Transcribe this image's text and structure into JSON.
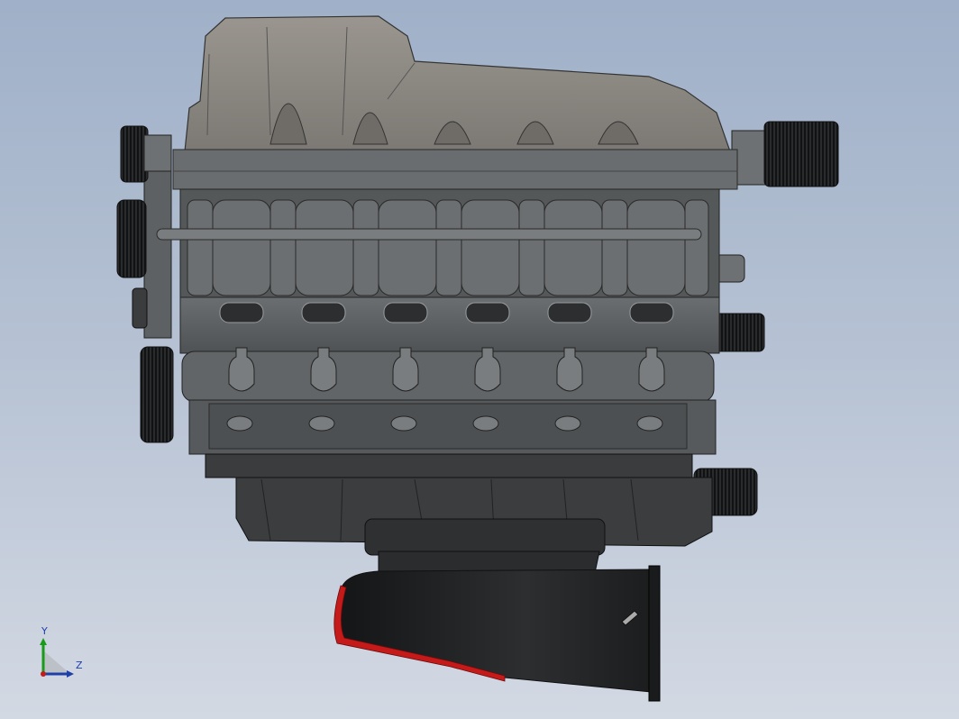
{
  "viewport": {
    "background_top": "#9fb0c8",
    "background_bottom": "#d3d9e3"
  },
  "model": {
    "subject": "engine-assembly",
    "colors": {
      "body": "#5b5e60",
      "body_light": "#7a7d7f",
      "cover": "#8d8a85",
      "dark": "#2b2d2f",
      "intake": "#1f2022",
      "accent_red": "#c41a1a"
    },
    "cylinders_per_bank": 6
  },
  "triad": {
    "y_label": "Y",
    "z_label": "Z",
    "y_color": "#1a9a1a",
    "z_color": "#1f3fa8"
  }
}
